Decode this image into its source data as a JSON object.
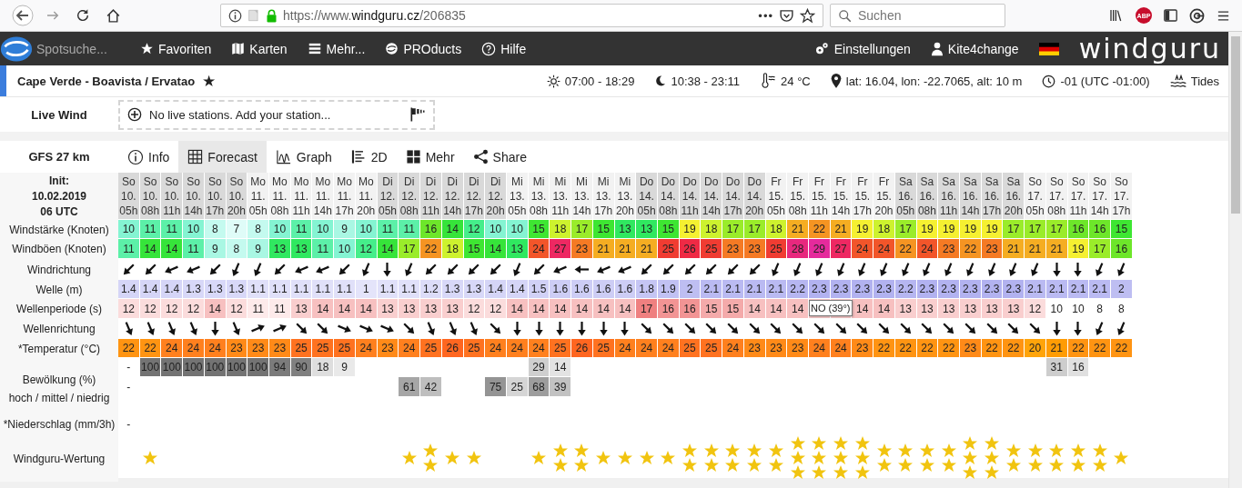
{
  "browser": {
    "url_prefix": "https://www.",
    "url_domain": "windguru.cz",
    "url_path": "/206835",
    "more": "•••",
    "search_placeholder": "Suchen",
    "adblock": "ABP"
  },
  "nav": {
    "search_placeholder": "Spotsuche...",
    "items": [
      "Favoriten",
      "Karten",
      "Mehr...",
      "PROducts",
      "Hilfe"
    ],
    "right": [
      "Einstellungen",
      "Kite4change"
    ],
    "logo": "windguru"
  },
  "spot": {
    "name": "Cape Verde - Boavista / Ervatao",
    "favorite": "★",
    "facts": [
      "07:00 - 18:29",
      "10:38 - 23:11",
      "24 °C",
      "lat: 16.04, lon: -22.7065, alt: 10 m",
      "-01 (UTC -01:00)",
      "Tides"
    ]
  },
  "live_wind": {
    "label": "Live Wind",
    "message": "No live stations. Add your station..."
  },
  "forecast": {
    "model": "GFS 27 km",
    "tabs": [
      {
        "label": "Info",
        "selected": false
      },
      {
        "label": "Forecast",
        "selected": true
      },
      {
        "label": "Graph",
        "selected": false
      },
      {
        "label": "2D",
        "selected": false
      },
      {
        "label": "Mehr",
        "selected": false
      },
      {
        "label": "Share",
        "selected": false
      }
    ],
    "init": [
      "Init:",
      "10.02.2019",
      "06 UTC"
    ],
    "row_labels": {
      "wind": "Windstärke (Knoten)",
      "gust": "Windböen (Knoten)",
      "wind_dir": "Windrichtung",
      "wave": "Welle (m)",
      "period": "Wellenperiode (s)",
      "wave_dir": "Wellenrichtung",
      "temp": "*Temperatur (°C)",
      "cloud": "Bewölkung (%)",
      "cloud_levels": "hoch / mittel / niedrig",
      "rain": "*Niederschlag (mm/3h)",
      "rating": "Windguru-Wertung"
    },
    "columns": [
      {
        "day": "So",
        "date": "10.",
        "hour": "05h",
        "wind": "10",
        "gust": "11",
        "wind_arrow": {
          "kind": "NE"
        },
        "wave": "1.4",
        "period": "12",
        "wave_arrow": {
          "kind": "NNW"
        },
        "temp": "22",
        "cloud_high": "-",
        "cloud_mid": "-",
        "rain": "-"
      },
      {
        "day": "So",
        "date": "10.",
        "hour": "08h",
        "wind": "11",
        "gust": "14",
        "wind_arrow": {
          "kind": "NE"
        },
        "wave": "1.4",
        "period": "12",
        "wave_arrow": {
          "kind": "NNW"
        },
        "temp": "22",
        "cloud_high": "100",
        "rating": [
          {
            "kind": "star"
          }
        ]
      },
      {
        "day": "So",
        "date": "10.",
        "hour": "11h",
        "wind": "11",
        "gust": "14",
        "wind_arrow": {
          "kind": "ENE"
        },
        "wave": "1.4",
        "period": "12",
        "wave_arrow": {
          "kind": "NNW"
        },
        "temp": "24",
        "cloud_high": "100"
      },
      {
        "day": "So",
        "date": "10.",
        "hour": "14h",
        "wind": "10",
        "gust": "11",
        "wind_arrow": {
          "kind": "ENE"
        },
        "wave": "1.3",
        "period": "12",
        "wave_arrow": {
          "kind": "NNW"
        },
        "temp": "24",
        "cloud_high": "100"
      },
      {
        "day": "So",
        "date": "10.",
        "hour": "17h",
        "wind": "8",
        "gust": "9",
        "wind_arrow": {
          "kind": "NE"
        },
        "wave": "1.3",
        "period": "14",
        "wave_arrow": {
          "kind": "N"
        },
        "temp": "24",
        "cloud_high": "100"
      },
      {
        "day": "So",
        "date": "10.",
        "hour": "20h",
        "wind": "7",
        "gust": "8",
        "wind_arrow": {
          "kind": "NNE"
        },
        "wave": "1.3",
        "period": "12",
        "wave_arrow": {
          "kind": "NNW"
        },
        "temp": "23",
        "cloud_high": "100"
      },
      {
        "day": "Mo",
        "date": "11.",
        "hour": "05h",
        "wind": "8",
        "gust": "9",
        "wind_arrow": {
          "kind": "NNE"
        },
        "wave": "1.1",
        "period": "11",
        "wave_arrow": {
          "kind": "WSW"
        },
        "temp": "23",
        "cloud_high": "100"
      },
      {
        "day": "Mo",
        "date": "11.",
        "hour": "08h",
        "wind": "10",
        "gust": "13",
        "wind_arrow": {
          "kind": "NE"
        },
        "wave": "1.1",
        "period": "11",
        "wave_arrow": {
          "kind": "WSW"
        },
        "temp": "23",
        "cloud_high": "94"
      },
      {
        "day": "Mo",
        "date": "11.",
        "hour": "11h",
        "wind": "11",
        "gust": "13",
        "wind_arrow": {
          "kind": "ENE"
        },
        "wave": "1.1",
        "period": "13",
        "wave_arrow": {
          "kind": "NW"
        },
        "temp": "25",
        "cloud_high": "90"
      },
      {
        "day": "Mo",
        "date": "11.",
        "hour": "14h",
        "wind": "10",
        "gust": "11",
        "wind_arrow": {
          "kind": "ENE"
        },
        "wave": "1.1",
        "period": "14",
        "wave_arrow": {
          "kind": "NW"
        },
        "temp": "25",
        "cloud_high": "18"
      },
      {
        "day": "Mo",
        "date": "11.",
        "hour": "17h",
        "wind": "9",
        "gust": "10",
        "wind_arrow": {
          "kind": "NE"
        },
        "wave": "1.1",
        "period": "14",
        "wave_arrow": {
          "kind": "WNW"
        },
        "temp": "25",
        "cloud_high": "9"
      },
      {
        "day": "Mo",
        "date": "11.",
        "hour": "20h",
        "wind": "10",
        "gust": "12",
        "wind_arrow": {
          "kind": "NNE"
        },
        "wave": "1",
        "period": "14",
        "wave_arrow": {
          "kind": "WNW"
        },
        "temp": "24"
      },
      {
        "day": "Di",
        "date": "12.",
        "hour": "05h",
        "wind": "11",
        "gust": "14",
        "wind_arrow": {
          "kind": "N"
        },
        "wave": "1.1",
        "period": "13",
        "wave_arrow": {
          "kind": "WNW"
        },
        "temp": "23"
      },
      {
        "day": "Di",
        "date": "12.",
        "hour": "08h",
        "wind": "11",
        "gust": "17",
        "wind_arrow": {
          "kind": "NNE"
        },
        "wave": "1.1",
        "period": "13",
        "wave_arrow": {
          "kind": "NW"
        },
        "temp": "24",
        "cloud_mid": "61",
        "rating": [
          {
            "kind": "star"
          }
        ]
      },
      {
        "day": "Di",
        "date": "12.",
        "hour": "11h",
        "wind": "16",
        "gust": "22",
        "wind_arrow": {
          "kind": "NE"
        },
        "wave": "1.2",
        "period": "13",
        "wave_arrow": {
          "kind": "NNW"
        },
        "temp": "25",
        "cloud_mid": "42",
        "rating": [
          {
            "kind": "star"
          },
          {
            "kind": "star"
          }
        ]
      },
      {
        "day": "Di",
        "date": "12.",
        "hour": "14h",
        "wind": "14",
        "gust": "18",
        "wind_arrow": {
          "kind": "NE"
        },
        "wave": "1.3",
        "period": "13",
        "wave_arrow": {
          "kind": "NNW"
        },
        "temp": "26",
        "rating": [
          {
            "kind": "star"
          }
        ]
      },
      {
        "day": "Di",
        "date": "12.",
        "hour": "17h",
        "wind": "12",
        "gust": "15",
        "wind_arrow": {
          "kind": "NE"
        },
        "wave": "1.3",
        "period": "12",
        "wave_arrow": {
          "kind": "NNW"
        },
        "temp": "25",
        "rating": [
          {
            "kind": "star"
          }
        ]
      },
      {
        "day": "Di",
        "date": "12.",
        "hour": "20h",
        "wind": "10",
        "gust": "14",
        "wind_arrow": {
          "kind": "NE"
        },
        "wave": "1.4",
        "period": "12",
        "wave_arrow": {
          "kind": "NW"
        },
        "temp": "24",
        "cloud_mid": "75"
      },
      {
        "day": "Mi",
        "date": "13.",
        "hour": "05h",
        "wind": "10",
        "gust": "13",
        "wind_arrow": {
          "kind": "NNE"
        },
        "wave": "1.4",
        "period": "14",
        "wave_arrow": {
          "kind": "N"
        },
        "temp": "24",
        "cloud_mid": "25"
      },
      {
        "day": "Mi",
        "date": "13.",
        "hour": "08h",
        "wind": "15",
        "gust": "24",
        "wind_arrow": {
          "kind": "NE"
        },
        "wave": "1.5",
        "period": "14",
        "wave_arrow": {
          "kind": "N"
        },
        "temp": "24",
        "cloud_high": "29",
        "cloud_mid": "68",
        "rating": [
          {
            "kind": "star"
          }
        ]
      },
      {
        "day": "Mi",
        "date": "13.",
        "hour": "11h",
        "wind": "18",
        "gust": "27",
        "wind_arrow": {
          "kind": "ENE"
        },
        "wave": "1.6",
        "period": "14",
        "wave_arrow": {
          "kind": "N"
        },
        "temp": "25",
        "cloud_high": "14",
        "cloud_mid": "39",
        "rating": [
          {
            "kind": "star"
          },
          {
            "kind": "star"
          }
        ]
      },
      {
        "day": "Mi",
        "date": "13.",
        "hour": "14h",
        "wind": "17",
        "gust": "23",
        "wind_arrow": {
          "kind": "E"
        },
        "wave": "1.6",
        "period": "14",
        "wave_arrow": {
          "kind": "N"
        },
        "temp": "26",
        "rating": [
          {
            "kind": "star"
          },
          {
            "kind": "star"
          }
        ]
      },
      {
        "day": "Mi",
        "date": "13.",
        "hour": "17h",
        "wind": "15",
        "gust": "21",
        "wind_arrow": {
          "kind": "ENE"
        },
        "wave": "1.6",
        "period": "14",
        "wave_arrow": {
          "kind": "N"
        },
        "temp": "25",
        "rating": [
          {
            "kind": "star"
          }
        ]
      },
      {
        "day": "Mi",
        "date": "13.",
        "hour": "20h",
        "wind": "13",
        "gust": "21",
        "wind_arrow": {
          "kind": "ENE"
        },
        "wave": "1.6",
        "period": "14",
        "wave_arrow": {
          "kind": "N"
        },
        "temp": "24",
        "rating": [
          {
            "kind": "star"
          }
        ]
      },
      {
        "day": "Do",
        "date": "14.",
        "hour": "05h",
        "wind": "13",
        "gust": "21",
        "wind_arrow": {
          "kind": "NE"
        },
        "wave": "1.8",
        "period": "17",
        "wave_arrow": {
          "kind": "NW"
        },
        "temp": "24",
        "rating": [
          {
            "kind": "star"
          }
        ]
      },
      {
        "day": "Do",
        "date": "14.",
        "hour": "08h",
        "wind": "15",
        "gust": "25",
        "wind_arrow": {
          "kind": "NE"
        },
        "wave": "1.9",
        "period": "16",
        "wave_arrow": {
          "kind": "NW"
        },
        "temp": "24",
        "rating": [
          {
            "kind": "star"
          }
        ]
      },
      {
        "day": "Do",
        "date": "14.",
        "hour": "11h",
        "wind": "19",
        "gust": "26",
        "wind_arrow": {
          "kind": "NE"
        },
        "wave": "2",
        "period": "16",
        "wave_arrow": {
          "kind": "NW"
        },
        "temp": "25",
        "rating": [
          {
            "kind": "star"
          },
          {
            "kind": "star"
          }
        ]
      },
      {
        "day": "Do",
        "date": "14.",
        "hour": "14h",
        "wind": "18",
        "gust": "25",
        "wind_arrow": {
          "kind": "NE"
        },
        "wave": "2.1",
        "period": "15",
        "wave_arrow": {
          "kind": "NW"
        },
        "temp": "25",
        "rating": [
          {
            "kind": "star"
          },
          {
            "kind": "star"
          }
        ]
      },
      {
        "day": "Do",
        "date": "14.",
        "hour": "17h",
        "wind": "17",
        "gust": "23",
        "wind_arrow": {
          "kind": "NE"
        },
        "wave": "2.1",
        "period": "15",
        "wave_arrow": {
          "kind": "NW"
        },
        "temp": "24",
        "rating": [
          {
            "kind": "star"
          },
          {
            "kind": "star"
          }
        ]
      },
      {
        "day": "Do",
        "date": "14.",
        "hour": "20h",
        "wind": "17",
        "gust": "23",
        "wind_arrow": {
          "kind": "NE"
        },
        "wave": "2.1",
        "period": "14",
        "wave_arrow": {
          "kind": "NW"
        },
        "temp": "23",
        "rating": [
          {
            "kind": "star"
          },
          {
            "kind": "star"
          }
        ]
      },
      {
        "day": "Fr",
        "date": "15.",
        "hour": "05h",
        "wind": "18",
        "gust": "25",
        "wind_arrow": {
          "kind": "NNE"
        },
        "wave": "2.1",
        "period": "14",
        "wave_arrow": {
          "kind": "NW"
        },
        "temp": "23",
        "rating": [
          {
            "kind": "star"
          },
          {
            "kind": "star"
          }
        ]
      },
      {
        "day": "Fr",
        "date": "15.",
        "hour": "08h",
        "wind": "21",
        "gust": "28",
        "wind_arrow": {
          "kind": "NNE"
        },
        "wave": "2.2",
        "period": "14",
        "wave_arrow": {
          "kind": "NW"
        },
        "temp": "23",
        "rating": [
          {
            "kind": "star"
          },
          {
            "kind": "star"
          },
          {
            "kind": "star"
          }
        ]
      },
      {
        "day": "Fr",
        "date": "15.",
        "hour": "11h",
        "wind": "22",
        "gust": "29",
        "wind_arrow": {
          "kind": "NNE"
        },
        "wave": "2.3",
        "wave_arrow": {
          "kind": "NW"
        },
        "temp": "24",
        "rating": [
          {
            "kind": "star"
          },
          {
            "kind": "star"
          },
          {
            "kind": "star"
          }
        ],
        "tooltip": "NO (39°)"
      },
      {
        "day": "Fr",
        "date": "15.",
        "hour": "14h",
        "wind": "21",
        "gust": "27",
        "wind_arrow": {
          "kind": "NNE"
        },
        "wave": "2.3",
        "wave_arrow": {
          "kind": "NW"
        },
        "temp": "24",
        "rating": [
          {
            "kind": "star"
          },
          {
            "kind": "star"
          },
          {
            "kind": "star"
          }
        ]
      },
      {
        "day": "Fr",
        "date": "15.",
        "hour": "17h",
        "wind": "19",
        "gust": "24",
        "wind_arrow": {
          "kind": "NNE"
        },
        "wave": "2.3",
        "period": "14",
        "wave_arrow": {
          "kind": "NW"
        },
        "temp": "23",
        "rating": [
          {
            "kind": "star"
          },
          {
            "kind": "star"
          },
          {
            "kind": "star"
          }
        ]
      },
      {
        "day": "Fr",
        "date": "15.",
        "hour": "20h",
        "wind": "18",
        "gust": "24",
        "wind_arrow": {
          "kind": "NNE"
        },
        "wave": "2.3",
        "period": "14",
        "wave_arrow": {
          "kind": "NW"
        },
        "temp": "22",
        "rating": [
          {
            "kind": "star"
          },
          {
            "kind": "star"
          }
        ]
      },
      {
        "day": "Sa",
        "date": "16.",
        "hour": "05h",
        "wind": "17",
        "gust": "22",
        "wind_arrow": {
          "kind": "NNE"
        },
        "wave": "2.2",
        "period": "13",
        "wave_arrow": {
          "kind": "NW"
        },
        "temp": "22",
        "rating": [
          {
            "kind": "star"
          },
          {
            "kind": "star"
          }
        ]
      },
      {
        "day": "Sa",
        "date": "16.",
        "hour": "08h",
        "wind": "19",
        "gust": "24",
        "wind_arrow": {
          "kind": "NNE"
        },
        "wave": "2.3",
        "period": "13",
        "wave_arrow": {
          "kind": "NW"
        },
        "temp": "22",
        "rating": [
          {
            "kind": "star"
          },
          {
            "kind": "star"
          }
        ]
      },
      {
        "day": "Sa",
        "date": "16.",
        "hour": "11h",
        "wind": "19",
        "gust": "23",
        "wind_arrow": {
          "kind": "NNE"
        },
        "wave": "2.3",
        "period": "13",
        "wave_arrow": {
          "kind": "NW"
        },
        "temp": "22",
        "rating": [
          {
            "kind": "star"
          },
          {
            "kind": "star"
          }
        ]
      },
      {
        "day": "Sa",
        "date": "16.",
        "hour": "14h",
        "wind": "19",
        "gust": "22",
        "wind_arrow": {
          "kind": "NNE"
        },
        "wave": "2.3",
        "period": "13",
        "wave_arrow": {
          "kind": "NW"
        },
        "temp": "23",
        "rating": [
          {
            "kind": "star"
          },
          {
            "kind": "star"
          },
          {
            "kind": "star"
          }
        ]
      },
      {
        "day": "Sa",
        "date": "16.",
        "hour": "17h",
        "wind": "19",
        "gust": "23",
        "wind_arrow": {
          "kind": "NNE"
        },
        "wave": "2.3",
        "period": "13",
        "wave_arrow": {
          "kind": "NW"
        },
        "temp": "22",
        "rating": [
          {
            "kind": "star"
          },
          {
            "kind": "star"
          },
          {
            "kind": "star"
          }
        ]
      },
      {
        "day": "Sa",
        "date": "16.",
        "hour": "20h",
        "wind": "17",
        "gust": "21",
        "wind_arrow": {
          "kind": "NNE"
        },
        "wave": "2.3",
        "period": "13",
        "wave_arrow": {
          "kind": "NW"
        },
        "temp": "22",
        "rating": [
          {
            "kind": "star"
          },
          {
            "kind": "star"
          }
        ]
      },
      {
        "day": "So",
        "date": "17.",
        "hour": "05h",
        "wind": "17",
        "gust": "21",
        "wind_arrow": {
          "kind": "NNE"
        },
        "wave": "2.1",
        "period": "12",
        "wave_arrow": {
          "kind": "NW"
        },
        "temp": "20",
        "rating": [
          {
            "kind": "star"
          },
          {
            "kind": "star"
          }
        ]
      },
      {
        "day": "So",
        "date": "17.",
        "hour": "08h",
        "wind": "17",
        "gust": "21",
        "wind_arrow": {
          "kind": "N"
        },
        "wave": "2.1",
        "period": "10",
        "wave_arrow": {
          "kind": "N"
        },
        "temp": "21",
        "cloud_high": "31",
        "rating": [
          {
            "kind": "star"
          },
          {
            "kind": "star"
          }
        ]
      },
      {
        "day": "So",
        "date": "17.",
        "hour": "11h",
        "wind": "16",
        "gust": "19",
        "wind_arrow": {
          "kind": "N"
        },
        "wave": "2.1",
        "period": "10",
        "wave_arrow": {
          "kind": "N"
        },
        "temp": "22",
        "cloud_high": "16",
        "rating": [
          {
            "kind": "star"
          },
          {
            "kind": "star"
          }
        ]
      },
      {
        "day": "So",
        "date": "17.",
        "hour": "14h",
        "wind": "16",
        "gust": "17",
        "wind_arrow": {
          "kind": "NNE"
        },
        "wave": "2.1",
        "period": "8",
        "wave_arrow": {
          "kind": "NNE"
        },
        "temp": "22",
        "rating": [
          {
            "kind": "star"
          },
          {
            "kind": "star"
          }
        ]
      },
      {
        "day": "So",
        "date": "17.",
        "hour": "17h",
        "wind": "15",
        "gust": "16",
        "wind_arrow": {
          "kind": "NNE"
        },
        "wave": "2",
        "period": "8",
        "wave_arrow": {
          "kind": "NNE"
        },
        "temp": "22",
        "rating": [
          {
            "kind": "star"
          }
        ]
      }
    ]
  }
}
